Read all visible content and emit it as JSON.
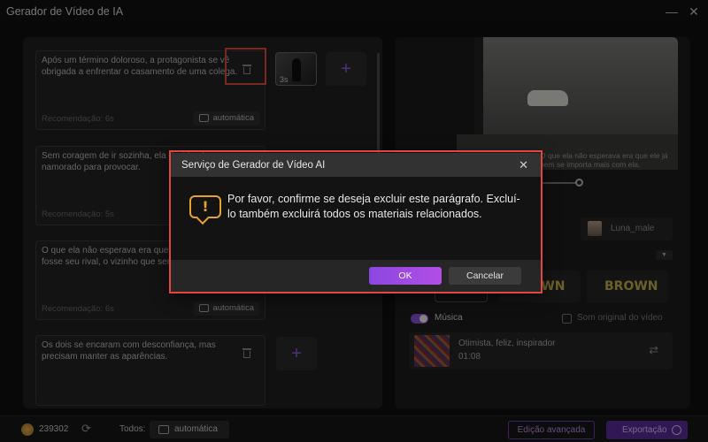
{
  "window": {
    "title": "Gerador de Vídeo de IA",
    "minimize_icon": "minimize-icon",
    "close_icon": "close-icon"
  },
  "paragraphs": [
    {
      "text": "Após um término doloroso, a protagonista se vê obrigada a enfrentar o casamento de uma colega.",
      "recommendation": "Recomendação: 6s",
      "mode": "automática",
      "thumb_duration": "3s"
    },
    {
      "text": "Sem coragem de ir sozinha, ela decide alugar um namorado para provocar.",
      "recommendation": "Recomendação: 5s",
      "mode": "automática"
    },
    {
      "text": "O que ela não esperava era que o acompanhante fosse seu rival, o vizinho que sempre detestou.",
      "recommendation": "Recomendação: 6s",
      "mode": "automática"
    },
    {
      "text": "Os dois se encaram com desconfiança, mas precisam manter as aparências.",
      "recommendation": "",
      "mode": ""
    }
  ],
  "preview": {
    "subtitle": "O que ela não esperava era que ele já nem se importa mais com ela."
  },
  "voice": {
    "name": "Luna_male"
  },
  "styles": {
    "tile_a": "BROWN",
    "tile_b": "BROWN"
  },
  "music": {
    "toggle_label": "Música",
    "original_label": "Som original do vídeo",
    "track_title": "Otimista, feliz, inspirador",
    "track_duration": "01:08"
  },
  "bottom": {
    "credits": "239302",
    "todos_label": "Todos:",
    "mode": "automática",
    "advanced": "Edição avançada",
    "export": "Exportação"
  },
  "dialog": {
    "title": "Serviço de Gerador de Vídeo AI",
    "message": "Por favor, confirme se deseja excluir este parágrafo. Excluí-lo também excluirá todos os materiais relacionados.",
    "ok": "OK",
    "cancel": "Cancelar"
  },
  "colors": {
    "accent": "#8b46e0",
    "warning": "#e7a12f",
    "highlight": "#e0473f"
  }
}
